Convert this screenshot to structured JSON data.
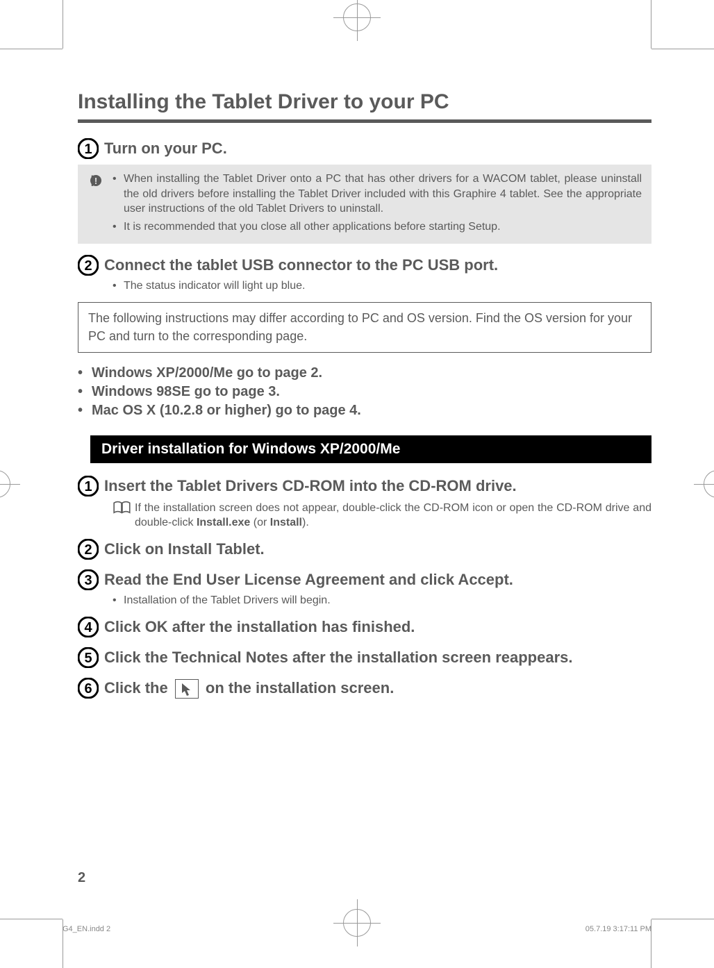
{
  "title": "Installing the Tablet Driver to your PC",
  "steps_initial": [
    {
      "num": "1",
      "title": "Turn on your PC."
    },
    {
      "num": "2",
      "title": "Connect the tablet USB connector to the PC USB port."
    }
  ],
  "warning": {
    "items": [
      "When installing the Tablet Driver onto a PC that has other drivers for a WACOM tablet, please uninstall the old drivers before installing the Tablet Driver included with this Graphire 4 tablet. See the appropriate user instructions of the old Tablet Drivers to uninstall.",
      "It is recommended that you close all other applications before starting Setup."
    ]
  },
  "step2_sub": "The status indicator will light up blue.",
  "framed_note": "The following instructions may differ according to PC and OS version. Find the OS version for your PC and turn to the corresponding page.",
  "os_list": [
    "Windows XP/2000/Me go to page 2.",
    "Windows 98SE go to page 3.",
    "Mac OS X (10.2.8 or higher) go to page 4."
  ],
  "section_title": "Driver installation for Windows XP/2000/Me",
  "win_steps": [
    {
      "num": "1",
      "title": "Insert the Tablet Drivers CD-ROM into the CD-ROM drive."
    },
    {
      "num": "2",
      "title": "Click on Install Tablet."
    },
    {
      "num": "3",
      "title": "Read the End User License Agreement and click Accept."
    },
    {
      "num": "4",
      "title": "Click OK after the installation has finished."
    },
    {
      "num": "5",
      "title": "Click the Technical Notes after the installation screen reappears."
    },
    {
      "num": "6",
      "title_pre": "Click the ",
      "title_post": " on the installation screen."
    }
  ],
  "tip1_pre": "If the installation screen does not appear, double-click the CD-ROM icon or open the CD-ROM drive and double-click ",
  "tip1_bold1": "Install.exe",
  "tip1_mid": " (or ",
  "tip1_bold2": "Install",
  "tip1_post": ").",
  "step3_sub": "Installation of the Tablet Drivers will begin.",
  "page_num": "2",
  "footer_left": "G4_EN.indd   2",
  "footer_right": "05.7.19   3:17:11 PM"
}
